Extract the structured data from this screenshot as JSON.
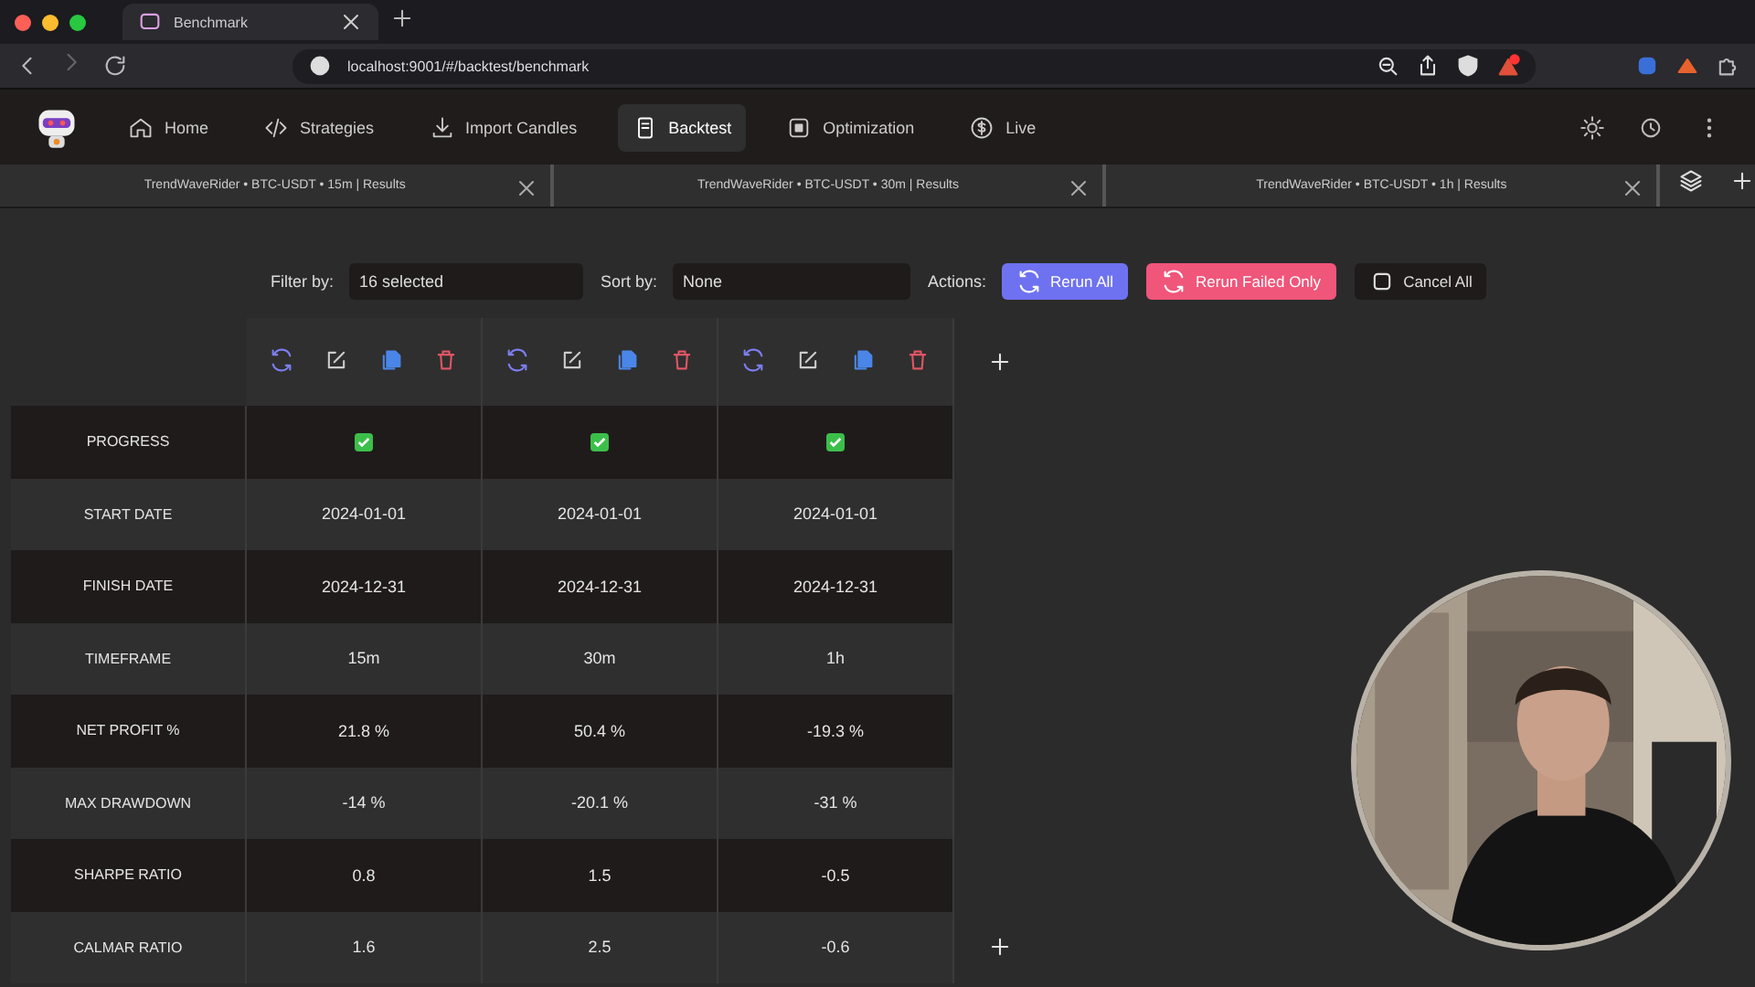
{
  "browser": {
    "tab_title": "Benchmark",
    "url": "localhost:9001/#/backtest/benchmark"
  },
  "nav": {
    "items": [
      {
        "label": "Home",
        "selected": false
      },
      {
        "label": "Strategies",
        "selected": false
      },
      {
        "label": "Import Candles",
        "selected": false
      },
      {
        "label": "Backtest",
        "selected": true
      },
      {
        "label": "Optimization",
        "selected": false
      },
      {
        "label": "Live",
        "selected": false
      }
    ]
  },
  "result_tabs": [
    {
      "label": "TrendWaveRider • BTC-USDT • 15m | Results"
    },
    {
      "label": "TrendWaveRider • BTC-USDT • 30m | Results"
    },
    {
      "label": "TrendWaveRider • BTC-USDT • 1h | Results"
    }
  ],
  "toolbar": {
    "filter": {
      "label": "Filter by:",
      "value": "16 selected"
    },
    "sort": {
      "label": "Sort by:",
      "value": "None"
    },
    "actions_label": "Actions:",
    "buttons": [
      {
        "label": "Rerun All",
        "kind": "primary"
      },
      {
        "label": "Rerun Failed Only",
        "kind": "danger"
      },
      {
        "label": "Cancel All",
        "kind": "plain"
      }
    ]
  },
  "table": {
    "rows": [
      {
        "label": "PROGRESS",
        "kind": "progress",
        "cells": [
          {
            "checked": true
          },
          {
            "checked": true
          },
          {
            "checked": true
          }
        ]
      },
      {
        "label": "START DATE",
        "kind": "text",
        "cells": [
          "2024-01-01",
          "2024-01-01",
          "2024-01-01"
        ]
      },
      {
        "label": "FINISH DATE",
        "kind": "text",
        "cells": [
          "2024-12-31",
          "2024-12-31",
          "2024-12-31"
        ]
      },
      {
        "label": "TIMEFRAME",
        "kind": "text",
        "cells": [
          "15m",
          "30m",
          "1h"
        ]
      },
      {
        "label": "NET PROFIT %",
        "kind": "text",
        "cells": [
          "21.8 %",
          "50.4 %",
          "-19.3 %"
        ]
      },
      {
        "label": "MAX DRAWDOWN",
        "kind": "text",
        "cells": [
          "-14 %",
          "-20.1 %",
          "-31 %"
        ]
      },
      {
        "label": "SHARPE RATIO",
        "kind": "text",
        "cells": [
          "0.8",
          "1.5",
          "-0.5"
        ]
      },
      {
        "label": "CALMAR RATIO",
        "kind": "text",
        "cells": [
          "1.6",
          "2.5",
          "-0.6"
        ]
      }
    ]
  }
}
